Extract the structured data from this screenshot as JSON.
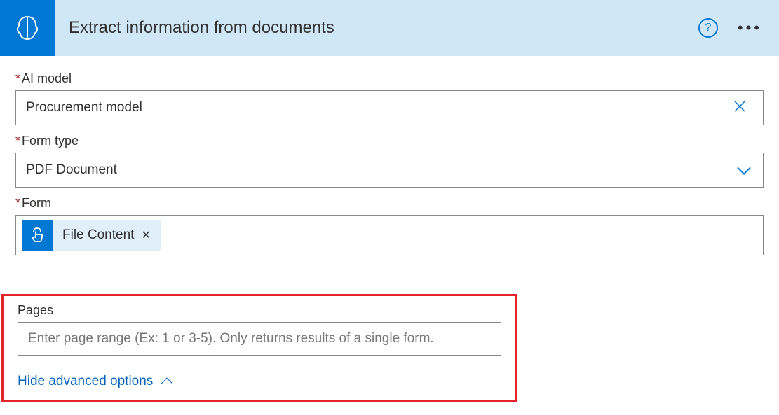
{
  "header": {
    "title": "Extract information from documents"
  },
  "fields": {
    "ai_model": {
      "label": "AI model",
      "value": "Procurement model"
    },
    "form_type": {
      "label": "Form type",
      "value": "PDF Document"
    },
    "form": {
      "label": "Form",
      "token_label": "File Content"
    },
    "pages": {
      "label": "Pages",
      "placeholder": "Enter page range (Ex: 1 or 3-5). Only returns results of a single form."
    }
  },
  "links": {
    "hide_advanced": "Hide advanced options"
  }
}
